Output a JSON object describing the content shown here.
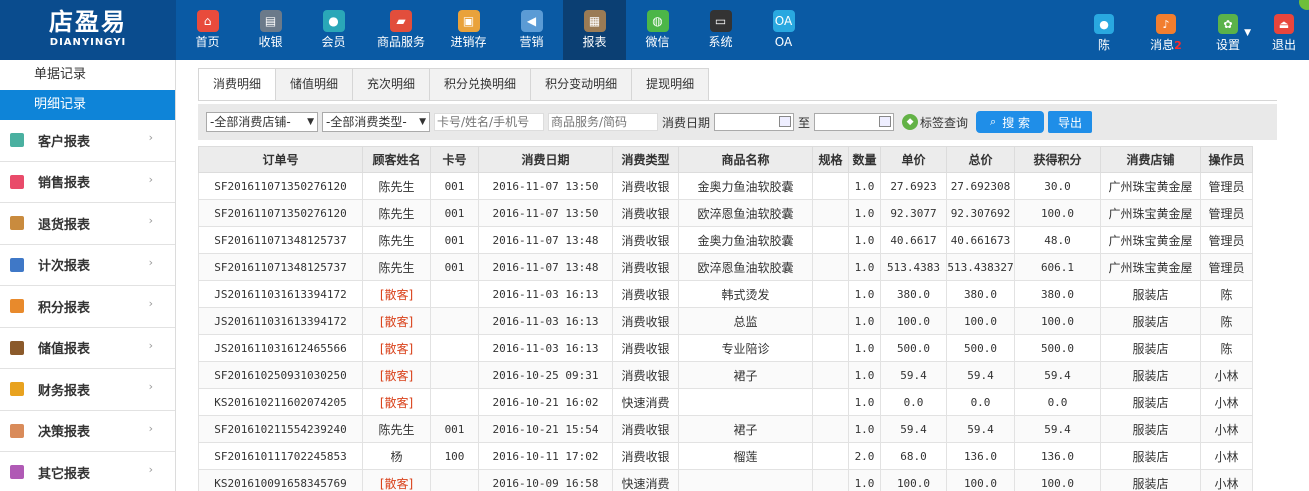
{
  "app": {
    "logo_cn": "店盈易",
    "logo_en": "DIANYINGYI"
  },
  "nav": [
    {
      "label": "首页",
      "icon": "home-icon",
      "color": "#e84b3c",
      "glyph": "⌂"
    },
    {
      "label": "收银",
      "icon": "cash-register-icon",
      "color": "#6b7a8a",
      "glyph": "▤"
    },
    {
      "label": "会员",
      "icon": "member-icon",
      "color": "#2aa7b8",
      "glyph": "●"
    },
    {
      "label": "商品服务",
      "icon": "goods-icon",
      "color": "#e24e3c",
      "glyph": "▰"
    },
    {
      "label": "进销存",
      "icon": "inventory-icon",
      "color": "#e9a23b",
      "glyph": "▣"
    },
    {
      "label": "营销",
      "icon": "marketing-icon",
      "color": "#5b9bd5",
      "glyph": "◀"
    },
    {
      "label": "报表",
      "icon": "report-icon",
      "color": "#9a7b55",
      "glyph": "▦"
    },
    {
      "label": "微信",
      "icon": "wechat-icon",
      "color": "#4cb648",
      "glyph": "◍"
    },
    {
      "label": "系统",
      "icon": "system-icon",
      "color": "#333333",
      "glyph": "▭"
    },
    {
      "label": "OA",
      "icon": "oa-icon",
      "color": "#29a8e0",
      "glyph": "OA"
    }
  ],
  "right_nav": {
    "user": {
      "label": "陈",
      "icon": "user-icon",
      "color": "#29a8e0"
    },
    "messages": {
      "label": "消息",
      "count": "2",
      "icon": "bell-icon",
      "color": "#f27e2f"
    },
    "settings": {
      "label": "设置",
      "icon": "gear-icon",
      "color": "#5bb24a",
      "caret": "▼"
    },
    "logout": {
      "label": "退出",
      "icon": "logout-icon",
      "color": "#e8453c"
    }
  },
  "sidebar": {
    "sub_items": [
      {
        "label": "单据记录"
      },
      {
        "label": "明细记录"
      }
    ],
    "items": [
      {
        "label": "客户报表",
        "icon": "customer-report-icon",
        "color": "#4ab0a0"
      },
      {
        "label": "销售报表",
        "icon": "sales-report-icon",
        "color": "#e94b6a"
      },
      {
        "label": "退货报表",
        "icon": "return-report-icon",
        "color": "#c98b3e"
      },
      {
        "label": "计次报表",
        "icon": "count-report-icon",
        "color": "#3f78c7"
      },
      {
        "label": "积分报表",
        "icon": "points-report-icon",
        "color": "#e88a2c"
      },
      {
        "label": "储值报表",
        "icon": "stored-value-report-icon",
        "color": "#8b5a2b"
      },
      {
        "label": "财务报表",
        "icon": "finance-report-icon",
        "color": "#e8a21f"
      },
      {
        "label": "决策报表",
        "icon": "decision-report-icon",
        "color": "#d98b5a"
      },
      {
        "label": "其它报表",
        "icon": "other-report-icon",
        "color": "#b05ab5"
      }
    ],
    "arrow": "›"
  },
  "tabs": [
    {
      "label": "消费明细"
    },
    {
      "label": "储值明细"
    },
    {
      "label": "充次明细"
    },
    {
      "label": "积分兑换明细"
    },
    {
      "label": "积分变动明细"
    },
    {
      "label": "提现明细"
    }
  ],
  "filters": {
    "store_select": "-全部消费店铺-",
    "type_select": "-全部消费类型-",
    "card_placeholder": "卡号/姓名/手机号",
    "goods_placeholder": "商品服务/简码",
    "date_label": "消费日期",
    "to_label": "至",
    "tag_query": "标签查询",
    "search_button": "搜 索",
    "export_button": "导出",
    "select_caret": "▼"
  },
  "table": {
    "columns": [
      "订单号",
      "顾客姓名",
      "卡号",
      "消费日期",
      "消费类型",
      "商品名称",
      "规格",
      "数量",
      "单价",
      "总价",
      "获得积分",
      "消费店铺",
      "操作员"
    ],
    "rows": [
      [
        "SF201611071350276120",
        "陈先生",
        "001",
        "2016-11-07 13:50",
        "消费收银",
        "金奥力鱼油软胶囊",
        "",
        "1.0",
        "27.6923",
        "27.692308",
        "30.0",
        "广州珠宝黄金屋",
        "管理员"
      ],
      [
        "SF201611071350276120",
        "陈先生",
        "001",
        "2016-11-07 13:50",
        "消费收银",
        "欧淬恩鱼油软胶囊",
        "",
        "1.0",
        "92.3077",
        "92.307692",
        "100.0",
        "广州珠宝黄金屋",
        "管理员"
      ],
      [
        "SF201611071348125737",
        "陈先生",
        "001",
        "2016-11-07 13:48",
        "消费收银",
        "金奥力鱼油软胶囊",
        "",
        "1.0",
        "40.6617",
        "40.661673",
        "48.0",
        "广州珠宝黄金屋",
        "管理员"
      ],
      [
        "SF201611071348125737",
        "陈先生",
        "001",
        "2016-11-07 13:48",
        "消费收银",
        "欧淬恩鱼油软胶囊",
        "",
        "1.0",
        "513.4383",
        "513.438327",
        "606.1",
        "广州珠宝黄金屋",
        "管理员"
      ],
      [
        "JS201611031613394172",
        "[散客]",
        "",
        "2016-11-03 16:13",
        "消费收银",
        "韩式烫发",
        "",
        "1.0",
        "380.0",
        "380.0",
        "380.0",
        "服装店",
        "陈"
      ],
      [
        "JS201611031613394172",
        "[散客]",
        "",
        "2016-11-03 16:13",
        "消费收银",
        "总监",
        "",
        "1.0",
        "100.0",
        "100.0",
        "100.0",
        "服装店",
        "陈"
      ],
      [
        "JS201611031612465566",
        "[散客]",
        "",
        "2016-11-03 16:13",
        "消费收银",
        "专业陪诊",
        "",
        "1.0",
        "500.0",
        "500.0",
        "500.0",
        "服装店",
        "陈"
      ],
      [
        "SF201610250931030250",
        "[散客]",
        "",
        "2016-10-25 09:31",
        "消费收银",
        "裙子",
        "",
        "1.0",
        "59.4",
        "59.4",
        "59.4",
        "服装店",
        "小林"
      ],
      [
        "KS201610211602074205",
        "[散客]",
        "",
        "2016-10-21 16:02",
        "快速消费",
        "",
        "",
        "1.0",
        "0.0",
        "0.0",
        "0.0",
        "服装店",
        "小林"
      ],
      [
        "SF201610211554239240",
        "陈先生",
        "001",
        "2016-10-21 15:54",
        "消费收银",
        "裙子",
        "",
        "1.0",
        "59.4",
        "59.4",
        "59.4",
        "服装店",
        "小林"
      ],
      [
        "SF201610111702245853",
        "杨",
        "100",
        "2016-10-11 17:02",
        "消费收银",
        "榴莲",
        "",
        "2.0",
        "68.0",
        "136.0",
        "136.0",
        "服装店",
        "小林"
      ],
      [
        "KS201610091658345769",
        "[散客]",
        "",
        "2016-10-09 16:58",
        "快速消费",
        "",
        "",
        "1.0",
        "100.0",
        "100.0",
        "100.0",
        "服装店",
        "小林"
      ]
    ]
  }
}
